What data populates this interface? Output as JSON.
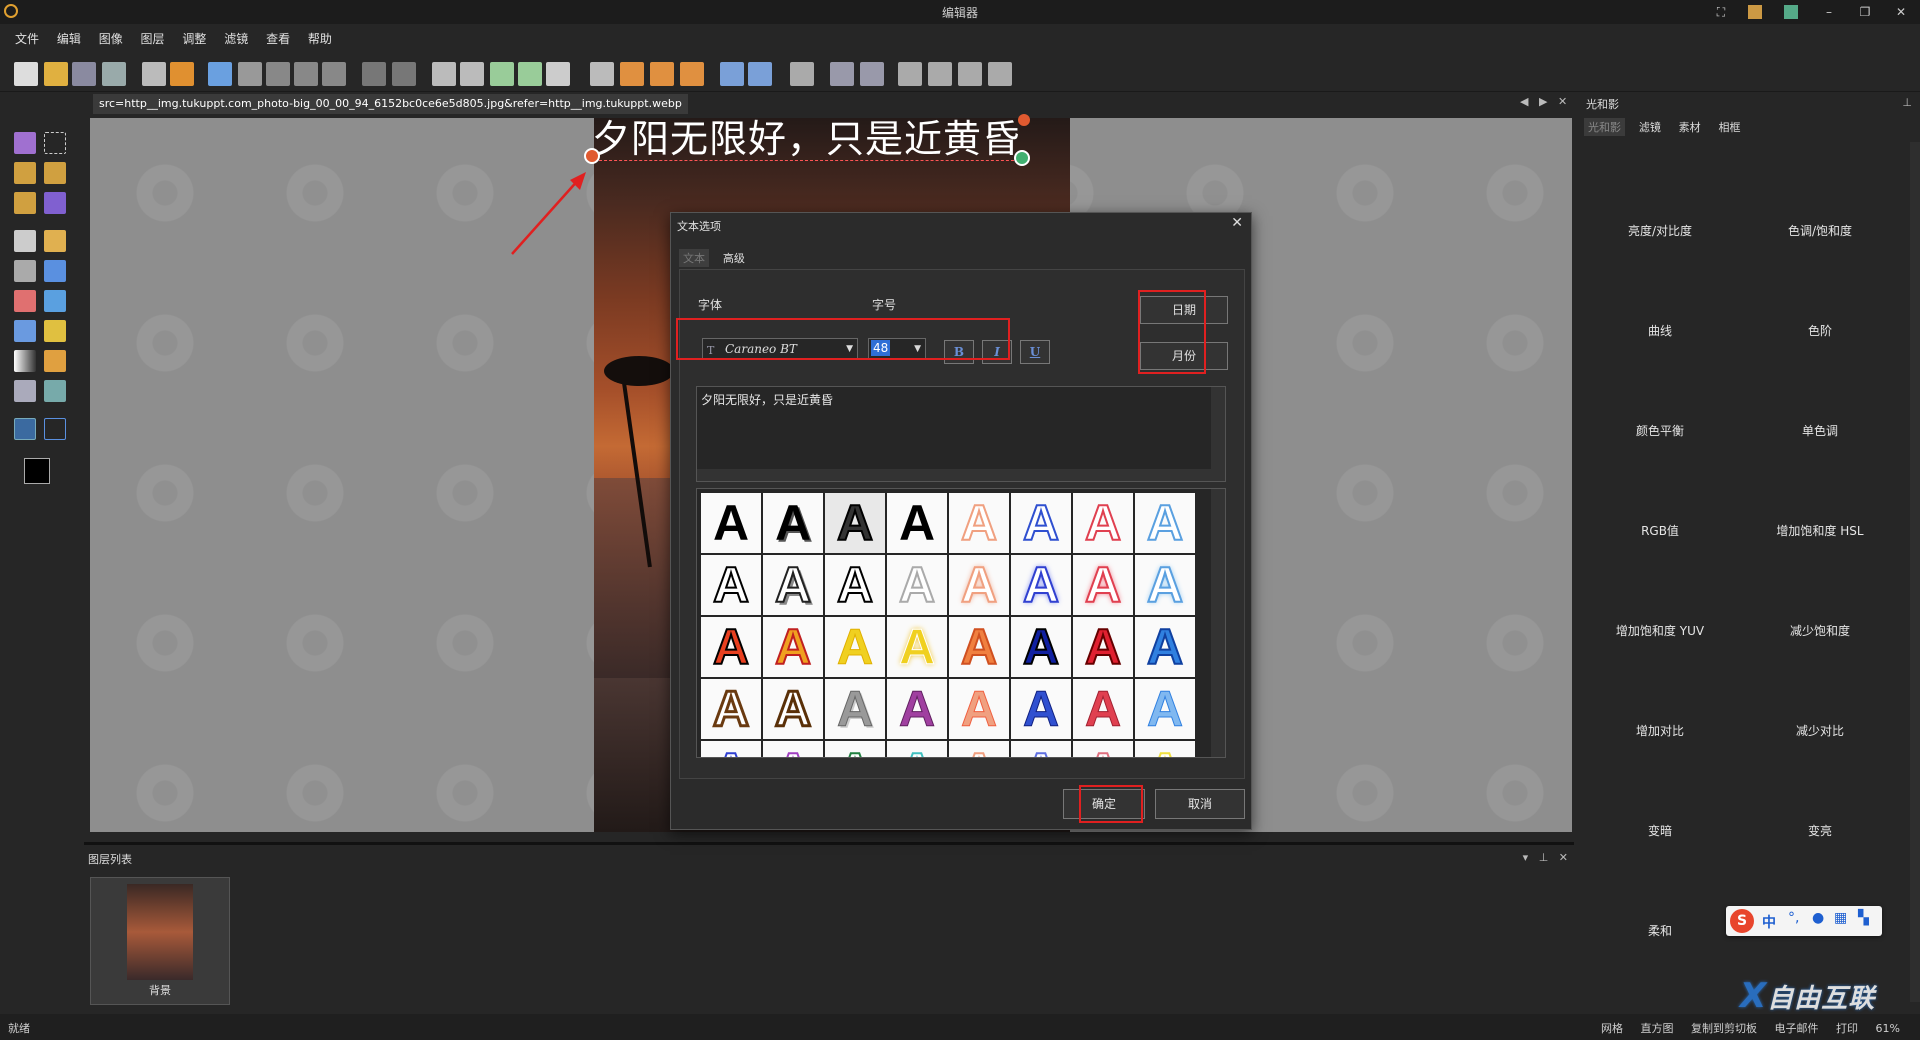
{
  "window": {
    "title": "编辑器"
  },
  "menu": [
    "文件",
    "编辑",
    "图像",
    "图层",
    "调整",
    "滤镜",
    "查看",
    "帮助"
  ],
  "document_tab": {
    "label": "src=http__img.tukuppt.com_photo-big_00_00_94_6152bc0ce6e5d805.jpg&refer=http__img.tukuppt.webp"
  },
  "canvas": {
    "overlay_text": "夕阳无限好，只是近黄昏"
  },
  "right_panel": {
    "title": "光和影",
    "tabs": [
      "光和影",
      "滤镜",
      "素材",
      "相框"
    ],
    "items": [
      "亮度/对比度",
      "色调/饱和度",
      "曲线",
      "色阶",
      "颜色平衡",
      "单色调",
      "RGB值",
      "增加饱和度 HSL",
      "增加饱和度 YUV",
      "减少饱和度",
      "增加对比",
      "减少对比",
      "变暗",
      "变亮",
      "柔和",
      ""
    ]
  },
  "layers": {
    "title": "图层列表",
    "items": [
      {
        "label": "背景"
      }
    ]
  },
  "status": {
    "left": "就绪",
    "right": [
      "网格",
      "直方图",
      "复制到剪切板",
      "电子邮件",
      "打印",
      "61%"
    ]
  },
  "dialog": {
    "title": "文本选项",
    "tabs": [
      "文本",
      "高级"
    ],
    "font_label": "字体",
    "size_label": "字号",
    "font_value": "Caraneo BT",
    "size_value": "48",
    "bold": "B",
    "italic": "I",
    "underline": "U",
    "date_button": "日期",
    "month_button": "月份",
    "text_value": "夕阳无限好，只是近黄昏",
    "ok": "确定",
    "cancel": "取消",
    "style_glyph": "A"
  },
  "ime": {
    "mode": "中"
  },
  "watermark": "自由互联"
}
